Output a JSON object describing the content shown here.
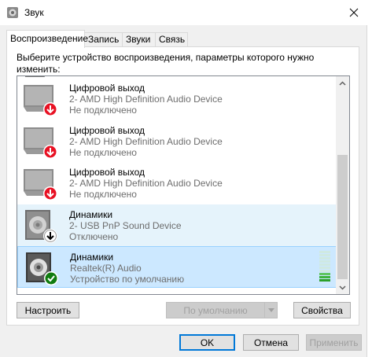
{
  "window": {
    "title": "Звук"
  },
  "tabs": [
    {
      "label": "Воспроизведение",
      "active": true
    },
    {
      "label": "Запись",
      "active": false
    },
    {
      "label": "Звуки",
      "active": false
    },
    {
      "label": "Связь",
      "active": false
    }
  ],
  "instruction": "Выберите устройство воспроизведения, параметры которого нужно изменить:",
  "devices": [
    {
      "name": "Цифровой выход",
      "device": "2- AMD High Definition Audio Device",
      "status": "Не подключено",
      "icon": "monitor-icon",
      "badge": "red-down-arrow"
    },
    {
      "name": "Цифровой выход",
      "device": "2- AMD High Definition Audio Device",
      "status": "Не подключено",
      "icon": "monitor-icon",
      "badge": "red-down-arrow"
    },
    {
      "name": "Цифровой выход",
      "device": "2- AMD High Definition Audio Device",
      "status": "Не подключено",
      "icon": "monitor-icon",
      "badge": "red-down-arrow"
    },
    {
      "name": "Динамики",
      "device": "2- USB PnP Sound Device",
      "status": "Отключено",
      "icon": "speaker-icon",
      "badge": "black-down-arrow"
    },
    {
      "name": "Динамики",
      "device": "Realtek(R) Audio",
      "status": "Устройство по умолчанию",
      "icon": "speaker-icon",
      "badge": "green-check"
    }
  ],
  "buttons": {
    "configure": "Настроить",
    "set_default": "По умолчанию",
    "properties": "Свойства",
    "ok": "OK",
    "cancel": "Отмена",
    "apply": "Применить"
  },
  "colors": {
    "accent": "#0078d7",
    "selected_hover": "#e5f3fb",
    "selected": "#cce8ff",
    "error_badge": "#e81123",
    "ok_badge": "#107c10"
  }
}
